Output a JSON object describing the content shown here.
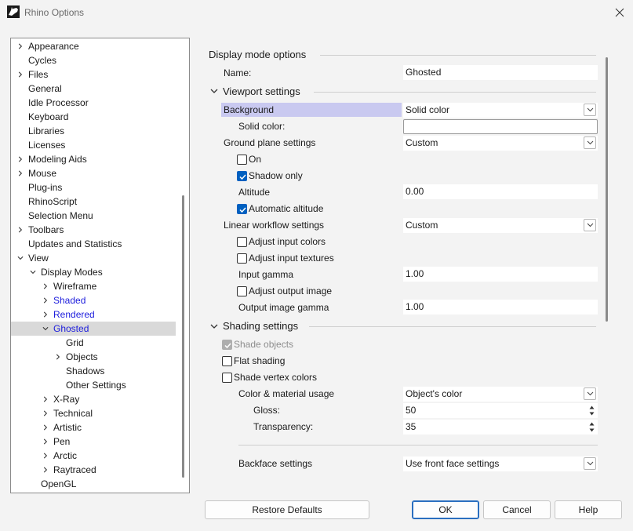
{
  "window": {
    "title": "Rhino Options"
  },
  "tree": [
    {
      "label": "Appearance",
      "level": 0,
      "expander": "collapsed"
    },
    {
      "label": "Cycles",
      "level": 0,
      "expander": "none"
    },
    {
      "label": "Files",
      "level": 0,
      "expander": "collapsed"
    },
    {
      "label": "General",
      "level": 0,
      "expander": "none"
    },
    {
      "label": "Idle Processor",
      "level": 0,
      "expander": "none"
    },
    {
      "label": "Keyboard",
      "level": 0,
      "expander": "none"
    },
    {
      "label": "Libraries",
      "level": 0,
      "expander": "none"
    },
    {
      "label": "Licenses",
      "level": 0,
      "expander": "none"
    },
    {
      "label": "Modeling Aids",
      "level": 0,
      "expander": "collapsed"
    },
    {
      "label": "Mouse",
      "level": 0,
      "expander": "collapsed"
    },
    {
      "label": "Plug-ins",
      "level": 0,
      "expander": "none"
    },
    {
      "label": "RhinoScript",
      "level": 0,
      "expander": "none"
    },
    {
      "label": "Selection Menu",
      "level": 0,
      "expander": "none"
    },
    {
      "label": "Toolbars",
      "level": 0,
      "expander": "collapsed"
    },
    {
      "label": "Updates and Statistics",
      "level": 0,
      "expander": "none"
    },
    {
      "label": "View",
      "level": 0,
      "expander": "expanded"
    },
    {
      "label": "Display Modes",
      "level": 1,
      "expander": "expanded"
    },
    {
      "label": "Wireframe",
      "level": 2,
      "expander": "collapsed"
    },
    {
      "label": "Shaded",
      "level": 2,
      "expander": "collapsed",
      "modified": true
    },
    {
      "label": "Rendered",
      "level": 2,
      "expander": "collapsed",
      "modified": true
    },
    {
      "label": "Ghosted",
      "level": 2,
      "expander": "expanded",
      "modified": true,
      "selected": true
    },
    {
      "label": "Grid",
      "level": 3,
      "expander": "none"
    },
    {
      "label": "Objects",
      "level": 3,
      "expander": "collapsed"
    },
    {
      "label": "Shadows",
      "level": 3,
      "expander": "none"
    },
    {
      "label": "Other Settings",
      "level": 3,
      "expander": "none"
    },
    {
      "label": "X-Ray",
      "level": 2,
      "expander": "collapsed"
    },
    {
      "label": "Technical",
      "level": 2,
      "expander": "collapsed"
    },
    {
      "label": "Artistic",
      "level": 2,
      "expander": "collapsed"
    },
    {
      "label": "Pen",
      "level": 2,
      "expander": "collapsed"
    },
    {
      "label": "Arctic",
      "level": 2,
      "expander": "collapsed"
    },
    {
      "label": "Raytraced",
      "level": 2,
      "expander": "collapsed"
    },
    {
      "label": "OpenGL",
      "level": 1,
      "expander": "none"
    }
  ],
  "panel": {
    "display_mode_header": "Display mode options",
    "name_label": "Name:",
    "name_value": "Ghosted",
    "viewport": {
      "header": "Viewport settings",
      "background_label": "Background",
      "background_value": "Solid color",
      "solid_color_label": "Solid color:",
      "ground_plane_label": "Ground plane settings",
      "ground_plane_value": "Custom",
      "on_label": "On",
      "on_checked": false,
      "shadow_only_label": "Shadow only",
      "shadow_only_checked": true,
      "altitude_label": "Altitude",
      "altitude_value": "0.00",
      "auto_altitude_label": "Automatic altitude",
      "auto_altitude_checked": true,
      "linear_workflow_label": "Linear workflow settings",
      "linear_workflow_value": "Custom",
      "adjust_input_colors_label": "Adjust input colors",
      "adjust_input_colors_checked": false,
      "adjust_input_textures_label": "Adjust input textures",
      "adjust_input_textures_checked": false,
      "input_gamma_label": "Input gamma",
      "input_gamma_value": "1.00",
      "adjust_output_image_label": "Adjust output image",
      "adjust_output_image_checked": false,
      "output_gamma_label": "Output image gamma",
      "output_gamma_value": "1.00"
    },
    "shading": {
      "header": "Shading settings",
      "shade_objects_label": "Shade objects",
      "shade_objects_checked": true,
      "flat_shading_label": "Flat shading",
      "flat_shading_checked": false,
      "shade_vertex_label": "Shade vertex colors",
      "shade_vertex_checked": false,
      "color_usage_label": "Color & material usage",
      "color_usage_value": "Object's color",
      "gloss_label": "Gloss:",
      "gloss_value": "50",
      "transparency_label": "Transparency:",
      "transparency_value": "35",
      "backface_label": "Backface settings",
      "backface_value": "Use front face settings"
    }
  },
  "buttons": {
    "restore": "Restore Defaults",
    "ok": "OK",
    "cancel": "Cancel",
    "help": "Help"
  }
}
